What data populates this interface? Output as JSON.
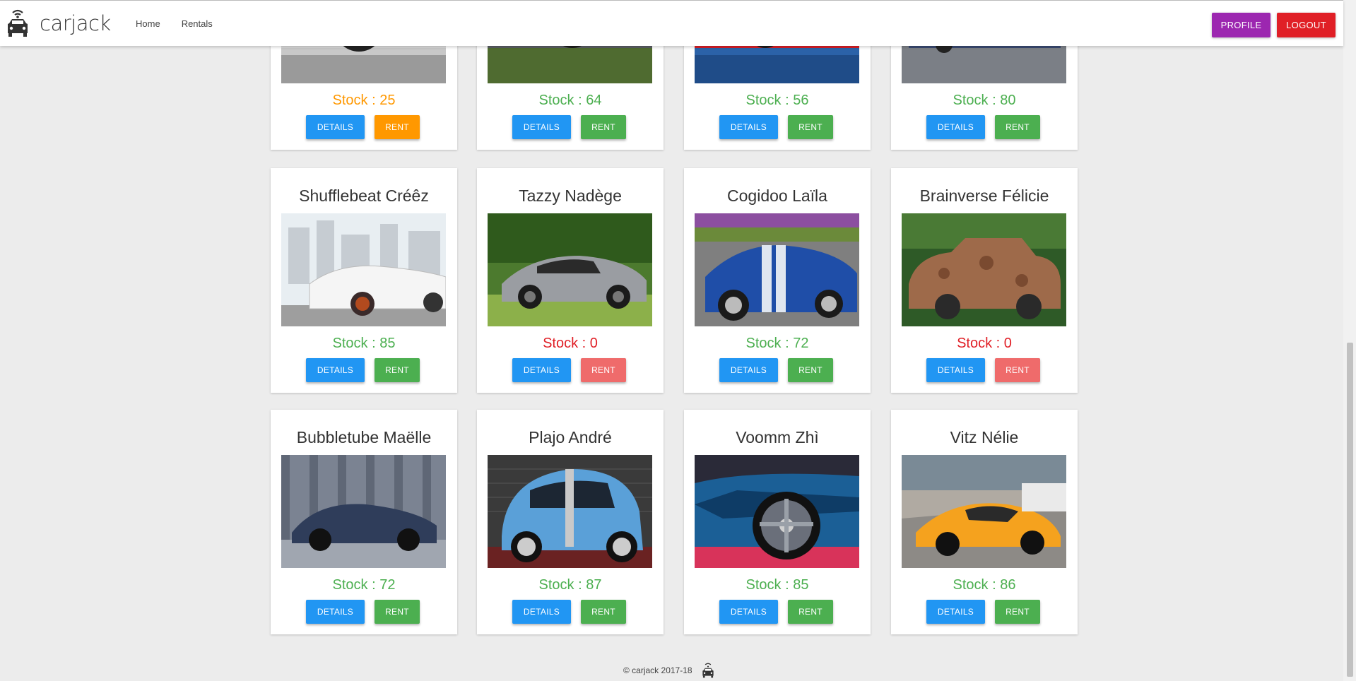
{
  "header": {
    "brand": "carjack",
    "nav": [
      "Home",
      "Rentals"
    ],
    "profile_label": "PROFILE",
    "logout_label": "LOGOUT"
  },
  "cars": [
    {
      "name": "",
      "stock_text": "Stock : 25",
      "stock_color": "#ff9800",
      "rent_color": "#ff9800",
      "details_label": "DETAILS",
      "rent_label": "RENT",
      "image": "silver-sports-car"
    },
    {
      "name": "",
      "stock_text": "Stock : 64",
      "stock_color": "#4caf50",
      "rent_color": "#4caf50",
      "details_label": "DETAILS",
      "rent_label": "RENT",
      "image": "grey-amg-car"
    },
    {
      "name": "",
      "stock_text": "Stock : 56",
      "stock_color": "#4caf50",
      "rent_color": "#4caf50",
      "details_label": "DETAILS",
      "rent_label": "RENT",
      "image": "red-sports-car"
    },
    {
      "name": "",
      "stock_text": "Stock : 80",
      "stock_color": "#4caf50",
      "rent_color": "#4caf50",
      "details_label": "DETAILS",
      "rent_label": "RENT",
      "image": "blue-grey-car"
    },
    {
      "name": "Shufflebeat Créêz",
      "stock_text": "Stock : 85",
      "stock_color": "#4caf50",
      "rent_color": "#4caf50",
      "details_label": "DETAILS",
      "rent_label": "RENT",
      "image": "white-sedan-city"
    },
    {
      "name": "Tazzy Nadège",
      "stock_text": "Stock : 0",
      "stock_color": "#e01f26",
      "rent_color": "#ef6b6b",
      "details_label": "DETAILS",
      "rent_label": "RENT",
      "image": "silver-amg-gt"
    },
    {
      "name": "Cogidoo Laïla",
      "stock_text": "Stock : 72",
      "stock_color": "#4caf50",
      "rent_color": "#4caf50",
      "details_label": "DETAILS",
      "rent_label": "RENT",
      "image": "blue-cobra-roadster"
    },
    {
      "name": "Brainverse Félicie",
      "stock_text": "Stock : 0",
      "stock_color": "#e01f26",
      "rent_color": "#ef6b6b",
      "details_label": "DETAILS",
      "rent_label": "RENT",
      "image": "rusty-vintage-car"
    },
    {
      "name": "Bubbletube Maëlle",
      "stock_text": "Stock : 72",
      "stock_color": "#4caf50",
      "rent_color": "#4caf50",
      "details_label": "DETAILS",
      "rent_label": "RENT",
      "image": "dark-blue-gt"
    },
    {
      "name": "Plajo André",
      "stock_text": "Stock : 87",
      "stock_color": "#4caf50",
      "rent_color": "#4caf50",
      "details_label": "DETAILS",
      "rent_label": "RENT",
      "image": "blue-smart-car"
    },
    {
      "name": "Voomm Zhì",
      "stock_text": "Stock : 85",
      "stock_color": "#4caf50",
      "rent_color": "#4caf50",
      "details_label": "DETAILS",
      "rent_label": "RENT",
      "image": "blue-lamborghini-wheel"
    },
    {
      "name": "Vitz Nélie",
      "stock_text": "Stock : 86",
      "stock_color": "#4caf50",
      "rent_color": "#4caf50",
      "details_label": "DETAILS",
      "rent_label": "RENT",
      "image": "orange-lamborghini"
    }
  ],
  "footer": {
    "text": "© carjack 2017-18"
  }
}
